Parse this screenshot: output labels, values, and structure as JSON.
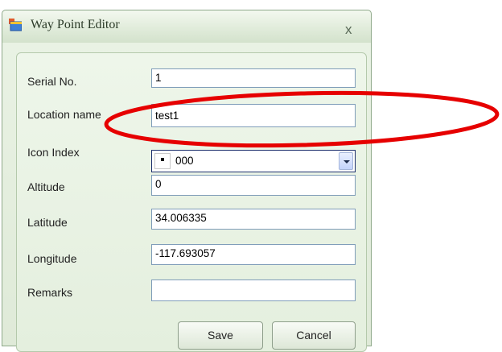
{
  "window": {
    "title": "Way Point Editor",
    "close_label": "x"
  },
  "form": {
    "serial_label": "Serial No.",
    "serial_value": "1",
    "location_label": "Location name",
    "location_value": "test1",
    "icon_label": "Icon Index",
    "icon_value": "000",
    "altitude_label": "Altitude",
    "altitude_value": "0",
    "latitude_label": "Latitude",
    "latitude_value": "34.006335",
    "longitude_label": "Longitude",
    "longitude_value": "-117.693057",
    "remarks_label": "Remarks",
    "remarks_value": ""
  },
  "buttons": {
    "save_label": "Save",
    "cancel_label": "Cancel"
  },
  "colors": {
    "annotation": "#e60000",
    "window_bg": "#dfead8"
  },
  "icons": [
    "app-window-icon",
    "close-icon",
    "dropdown-arrow-icon"
  ]
}
